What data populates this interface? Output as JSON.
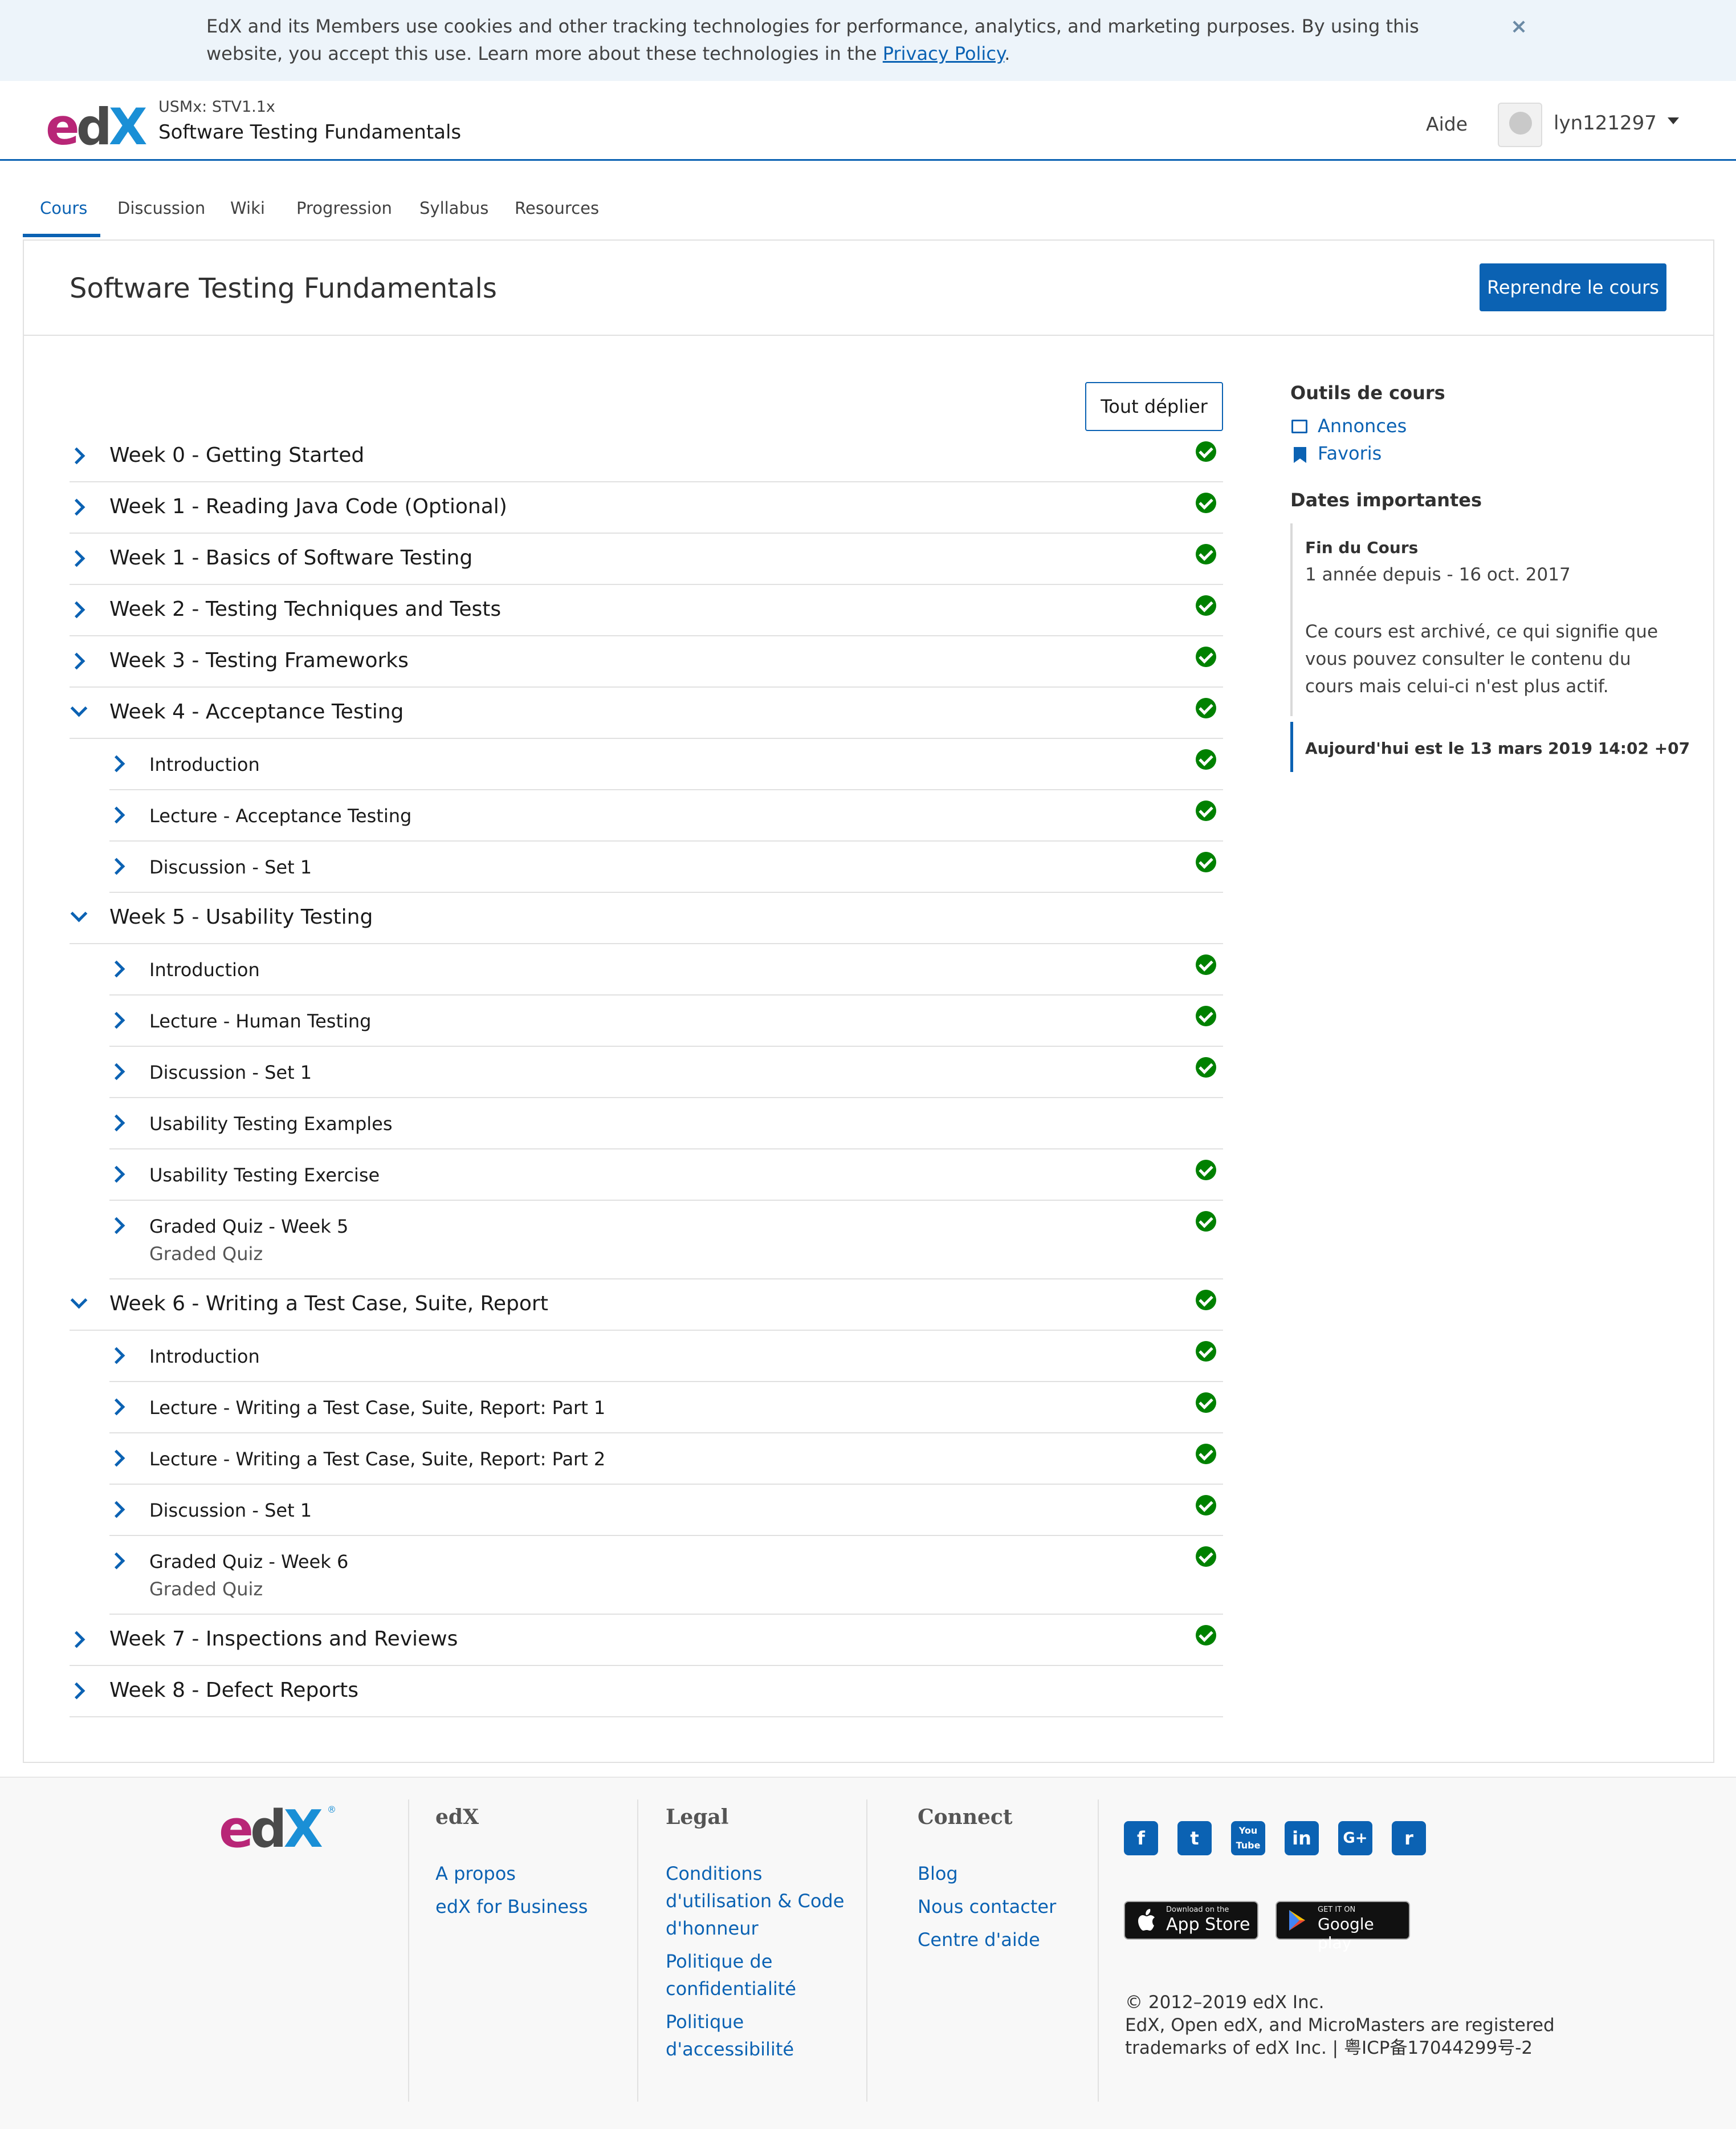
{
  "cookie_banner": {
    "text": "EdX and its Members use cookies and other tracking technologies for performance, analytics, and marketing purposes. By using this website, you accept this use. Learn more about these technologies in the ",
    "link": "Privacy Policy",
    "after": ".",
    "close": "×"
  },
  "header": {
    "logo": {
      "e": "e",
      "d": "d",
      "x": "X"
    },
    "course_org": "USMx: STV1.1x",
    "course_name": "Software Testing Fundamentals",
    "help": "Aide",
    "username": "lyn121297"
  },
  "tabs": [
    "Cours",
    "Discussion",
    "Wiki",
    "Progression",
    "Syllabus",
    "Resources"
  ],
  "main": {
    "title": "Software Testing Fundamentals",
    "resume_button": "Reprendre le cours",
    "expand_button": "Tout déplier"
  },
  "outline": [
    {
      "label": "Week 0 - Getting Started",
      "level": 0,
      "expanded": false,
      "complete": true
    },
    {
      "label": "Week 1 - Reading Java Code (Optional)",
      "level": 0,
      "expanded": false,
      "complete": true
    },
    {
      "label": "Week 1 - Basics of Software Testing",
      "level": 0,
      "expanded": false,
      "complete": true
    },
    {
      "label": "Week 2 - Testing Techniques and Tests",
      "level": 0,
      "expanded": false,
      "complete": true
    },
    {
      "label": "Week 3 - Testing Frameworks",
      "level": 0,
      "expanded": false,
      "complete": true
    },
    {
      "label": "Week 4 - Acceptance Testing",
      "level": 0,
      "expanded": true,
      "complete": true
    },
    {
      "label": "Introduction",
      "level": 1,
      "complete": true
    },
    {
      "label": "Lecture - Acceptance Testing",
      "level": 1,
      "complete": true
    },
    {
      "label": "Discussion - Set 1",
      "level": 1,
      "complete": true
    },
    {
      "label": "Week 5 - Usability Testing",
      "level": 0,
      "expanded": true,
      "complete": false
    },
    {
      "label": "Introduction",
      "level": 1,
      "complete": true
    },
    {
      "label": "Lecture - Human Testing",
      "level": 1,
      "complete": true
    },
    {
      "label": "Discussion - Set 1",
      "level": 1,
      "complete": true
    },
    {
      "label": "Usability Testing Examples",
      "level": 1,
      "complete": false
    },
    {
      "label": "Usability Testing Exercise",
      "level": 1,
      "complete": true
    },
    {
      "label": "Graded Quiz - Week 5",
      "sublabel": "Graded Quiz",
      "level": 1,
      "complete": true
    },
    {
      "label": "Week 6 - Writing a Test Case, Suite, Report",
      "level": 0,
      "expanded": true,
      "complete": true
    },
    {
      "label": "Introduction",
      "level": 1,
      "complete": true
    },
    {
      "label": "Lecture - Writing a Test Case, Suite, Report: Part 1",
      "level": 1,
      "complete": true
    },
    {
      "label": "Lecture - Writing a Test Case, Suite, Report: Part 2",
      "level": 1,
      "complete": true
    },
    {
      "label": "Discussion - Set 1",
      "level": 1,
      "complete": true
    },
    {
      "label": "Graded Quiz - Week 6",
      "sublabel": "Graded Quiz",
      "level": 1,
      "complete": true
    },
    {
      "label": "Week 7 - Inspections and Reviews",
      "level": 0,
      "expanded": false,
      "complete": true
    },
    {
      "label": "Week 8 - Defect Reports",
      "level": 0,
      "expanded": false,
      "complete": false
    }
  ],
  "sidebar": {
    "tools_heading": "Outils de cours",
    "tools": [
      "Annonces",
      "Favoris"
    ],
    "dates_heading": "Dates importantes",
    "end_label": "Fin du Cours",
    "end_date": "1 année depuis - 16 oct. 2017",
    "archived_text": "Ce cours est archivé, ce qui signifie que vous pouvez consulter le contenu du cours mais celui-ci n'est plus actif.",
    "today": "Aujourd'hui est le 13 mars 2019 14:02 +07"
  },
  "footer": {
    "logo": {
      "e": "e",
      "d": "d",
      "x": "X",
      "reg": "®"
    },
    "col_edx": {
      "heading": "edX",
      "links": [
        "A propos",
        "edX for Business"
      ]
    },
    "col_legal": {
      "heading": "Legal",
      "links": [
        "Conditions d'utilisation & Code d'honneur",
        "Politique de confidentialité",
        "Politique d'accessibilité"
      ]
    },
    "col_connect": {
      "heading": "Connect",
      "links": [
        "Blog",
        "Nous contacter",
        "Centre d'aide"
      ]
    },
    "social": [
      "f",
      "t",
      "You Tube",
      "in",
      "G+",
      "r"
    ],
    "app_store": {
      "small": "Download on the",
      "big": "App Store"
    },
    "google_play": {
      "small": "GET IT ON",
      "big": "Google play"
    },
    "copyright": "© 2012–2019 edX Inc.",
    "trademark": "EdX, Open edX, and MicroMasters are registered trademarks of edX Inc. | 粤ICP备17044299号-2"
  }
}
